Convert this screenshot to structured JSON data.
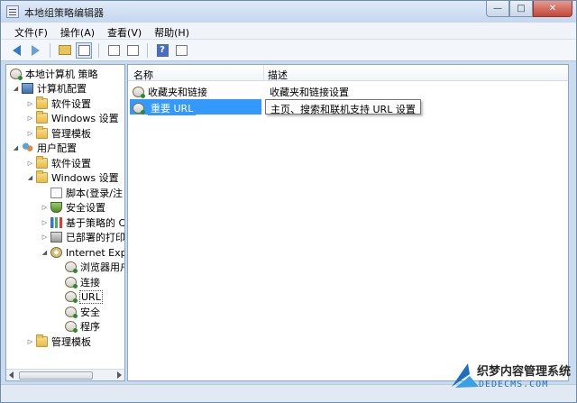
{
  "window": {
    "title": "本地组策略编辑器"
  },
  "menu": [
    {
      "label": "文件(F)"
    },
    {
      "label": "操作(A)"
    },
    {
      "label": "查看(V)"
    },
    {
      "label": "帮助(H)"
    }
  ],
  "tree": {
    "items": [
      {
        "label": "本地计算机 策略",
        "icon": "policy-icon"
      },
      {
        "label": "计算机配置",
        "icon": "computer-icon"
      },
      {
        "label": "软件设置",
        "icon": "folder-icon"
      },
      {
        "label": "Windows 设置",
        "icon": "folder-icon"
      },
      {
        "label": "管理模板",
        "icon": "folder-icon"
      },
      {
        "label": "用户配置",
        "icon": "users-icon"
      },
      {
        "label": "软件设置",
        "icon": "folder-icon"
      },
      {
        "label": "Windows 设置",
        "icon": "folder-icon"
      },
      {
        "label": "脚本(登录/注",
        "icon": "script-icon"
      },
      {
        "label": "安全设置",
        "icon": "security-icon"
      },
      {
        "label": "基于策略的 C",
        "icon": "qos-chart-icon"
      },
      {
        "label": "已部署的打印",
        "icon": "printer-icon"
      },
      {
        "label": "Internet Exp",
        "icon": "ie-icon"
      },
      {
        "label": "浏览器用户",
        "icon": "policy-folder-icon"
      },
      {
        "label": "连接",
        "icon": "policy-folder-icon"
      },
      {
        "label": "URL",
        "icon": "policy-folder-icon"
      },
      {
        "label": "安全",
        "icon": "policy-folder-icon"
      },
      {
        "label": "程序",
        "icon": "policy-folder-icon"
      },
      {
        "label": "管理模板",
        "icon": "folder-icon"
      }
    ]
  },
  "list": {
    "columns": [
      "名称",
      "描述"
    ],
    "rows": [
      {
        "name": "收藏夹和链接",
        "desc": "收藏夹和链接设置"
      },
      {
        "name": "重要 URL",
        "desc": "主页、搜索和联机支持 URL 设置"
      }
    ]
  },
  "watermark": {
    "brand": "织梦内容管理系统",
    "url": "DEDECMS.COM"
  },
  "colors": {
    "selection": "#3399ff",
    "frame": "#c9dbef",
    "close_button": "#c4463a"
  }
}
